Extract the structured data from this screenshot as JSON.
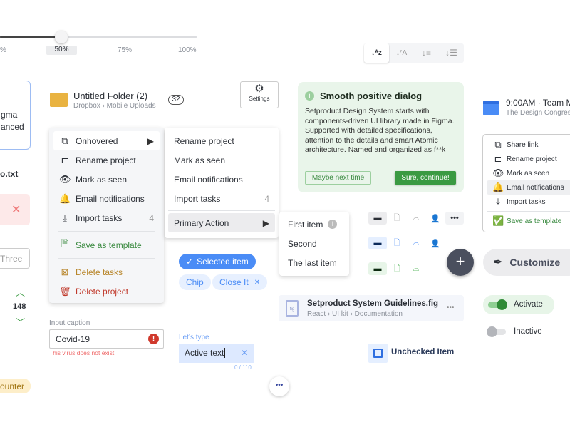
{
  "slider": {
    "value_percent": 50,
    "ticks": [
      "%",
      "50%",
      "75%",
      "100%"
    ]
  },
  "card_fragment": {
    "line1": "gma",
    "line2": "anced"
  },
  "file_fragment": "o.txt",
  "input_fragment": "Three",
  "counter": {
    "value": "148"
  },
  "badge_fragment": "ounter",
  "folder": {
    "title": "Untitled Folder (2)",
    "path": "Dropbox › Mobile Uploads",
    "count": "32"
  },
  "settings_button": "Settings",
  "sort_group": {
    "icons": [
      "sort-a-z-icon",
      "sort-z-a-icon",
      "sort-ascending-icon",
      "sort-descending-icon"
    ]
  },
  "context_menu": {
    "items": [
      {
        "label": "Onhovered"
      },
      {
        "label": "Rename project"
      },
      {
        "label": "Mark as seen"
      },
      {
        "label": "Email notifications"
      },
      {
        "label": "Import tasks",
        "count": "4"
      }
    ],
    "save": "Save as template",
    "delete_tasks": "Delete tasks",
    "delete_project": "Delete project"
  },
  "submenu": {
    "items": [
      "Rename project",
      "Mark as seen",
      "Email notifications",
      "Import tasks"
    ],
    "import_count": "4",
    "primary": "Primary Action"
  },
  "submenu2": {
    "items": [
      "First item",
      "Second",
      "The last item"
    ]
  },
  "dialog": {
    "title": "Smooth positive dialog",
    "body": "Setproduct Design System starts with components-driven UI library made in Figma. Supported with detailed specifications, attention to the details and smart Atomic architecture. Named and organized as f**k",
    "secondary": "Maybe next time",
    "primary": "Sure, continue!"
  },
  "event": {
    "title": "9:00AM · Team M",
    "subtitle": "The Design Congres"
  },
  "right_menu": {
    "items": [
      "Share link",
      "Rename project",
      "Mark as seen",
      "Email notifications",
      "Import tasks"
    ],
    "save": "Save as template"
  },
  "chips": {
    "selected": "Selected item",
    "chip": "Chip",
    "close": "Close It"
  },
  "input_error": {
    "caption": "Input caption",
    "value": "Covid-19",
    "error": "This virus does not exist"
  },
  "input_active": {
    "caption": "Let’s type",
    "value": "Active text",
    "counter": "0 / 110"
  },
  "file": {
    "name": "Setproduct System Guidelines.fig",
    "path": "React › UI kit › Documentation",
    "icon_label": "fig"
  },
  "customize": "Customize",
  "toggles": {
    "on": "Activate",
    "off": "Inactive"
  },
  "checkbox": {
    "label": "Unchecked Item",
    "checked": false
  },
  "colors": {
    "green": "#3a9a42",
    "blue": "#4a8cf6",
    "red": "#d0392c",
    "gold": "#b8862b",
    "dark": "#4a4f5e"
  }
}
